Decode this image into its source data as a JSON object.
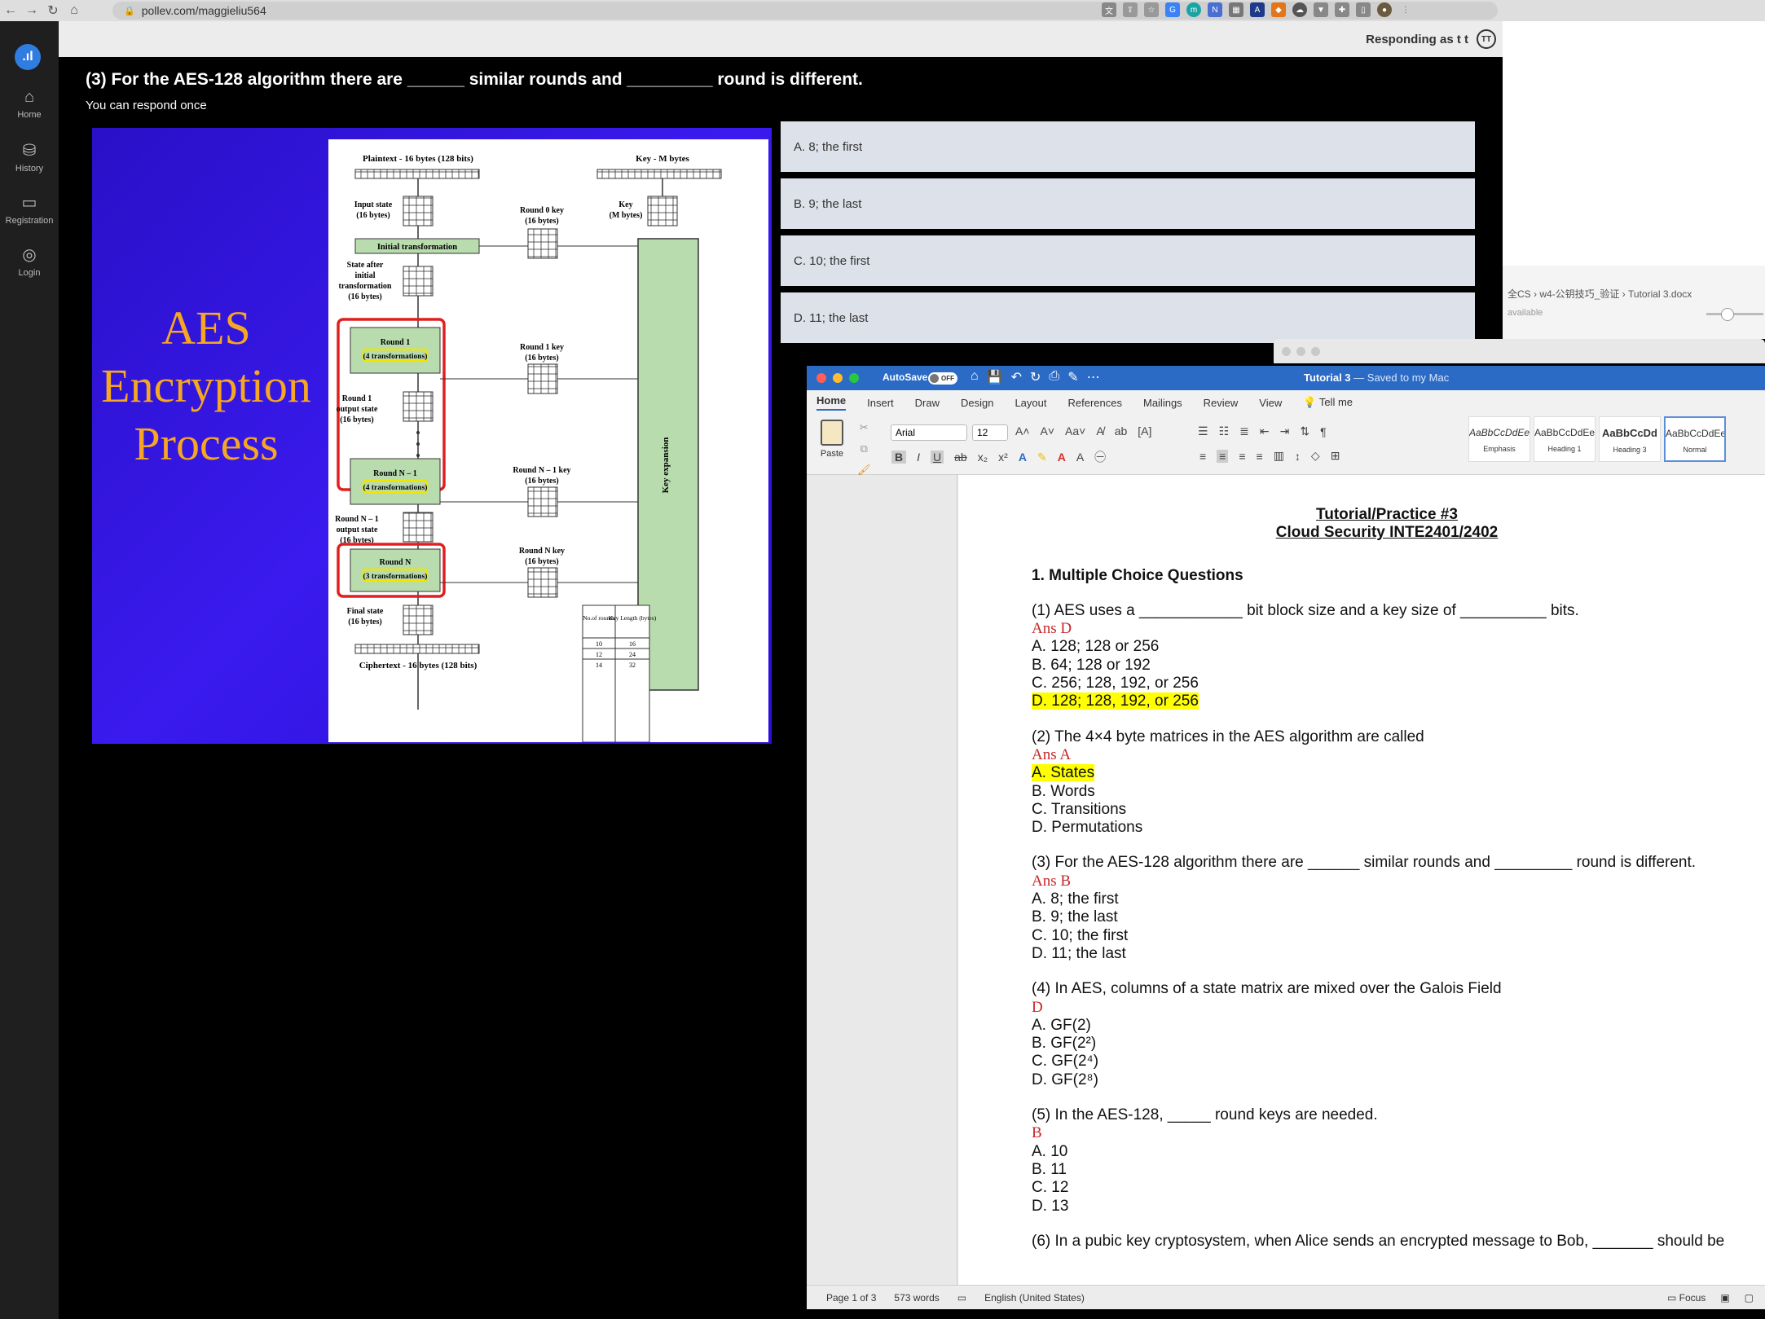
{
  "browser": {
    "url": "pollev.com/maggieliu564"
  },
  "rail": {
    "items": [
      {
        "label": "Home",
        "icon": "home-icon"
      },
      {
        "label": "History",
        "icon": "history-icon"
      },
      {
        "label": "Registration",
        "icon": "registration-icon"
      },
      {
        "label": "Login",
        "icon": "login-icon"
      }
    ]
  },
  "poll": {
    "responding": "Responding as t t",
    "avatar": "TT",
    "question": "(3) For the AES-128 algorithm there are ______ similar rounds and _________ round is different.",
    "note": "You can respond once",
    "options": [
      "A. 8; the first",
      "B. 9; the last",
      "C. 10; the first",
      "D. 11; the last"
    ],
    "slide": {
      "title_lines": [
        "AES",
        "Encryption",
        "Process"
      ],
      "plaintext": "Plaintext - 16 bytes (128 bits)",
      "key": "Key - M bytes",
      "input_state": [
        "Input state",
        "(16 bytes)"
      ],
      "key_m": [
        "Key",
        "(M bytes)"
      ],
      "round0_key": [
        "Round 0 key",
        "(16 bytes)"
      ],
      "initial_transformation": "Initial transformation",
      "state_after": [
        "State after",
        "initial",
        "transformation",
        "(16 bytes)"
      ],
      "round1": [
        "Round 1",
        "(4 transformations)"
      ],
      "round1_key": [
        "Round 1 key",
        "(16 bytes)"
      ],
      "key_expansion": "Key expansion",
      "round1_output": [
        "Round 1",
        "output state",
        "(16 bytes)"
      ],
      "roundN1": [
        "Round N – 1",
        "(4 transformations)"
      ],
      "roundN1_key": [
        "Round N – 1 key",
        "(16 bytes)"
      ],
      "roundN1_output": [
        "Round N – 1",
        "output state",
        "(16 bytes)"
      ],
      "roundN": [
        "Round N",
        "(3 transformations)"
      ],
      "roundN_key": [
        "Round N key",
        "(16 bytes)"
      ],
      "final_state": [
        "Final state",
        "(16 bytes)"
      ],
      "ciphertext": "Ciphertext - 16 bytes (128 bits)",
      "table_headers": [
        "No.of rounds",
        "Key Length (bytes)"
      ],
      "table_rows": [
        [
          "10",
          "16"
        ],
        [
          "12",
          "24"
        ],
        [
          "14",
          "32"
        ]
      ]
    }
  },
  "finder": {
    "path": "全CS › w4-公钥技巧_验证 › Tutorial 3.docx",
    "available": "available"
  },
  "word": {
    "autosave": "AutoSave",
    "toggle": "OFF",
    "doc_title": "Tutorial 3",
    "saved": " — Saved to my Mac",
    "tabs": [
      "Home",
      "Insert",
      "Draw",
      "Design",
      "Layout",
      "References",
      "Mailings",
      "Review",
      "View",
      "Tell me"
    ],
    "paste": "Paste",
    "font": "Arial",
    "size": "12",
    "styles": [
      {
        "sample": "AaBbCcDdEe",
        "name": "Emphasis"
      },
      {
        "sample": "AaBbCcDdEe",
        "name": "Heading 1"
      },
      {
        "sample": "AaBbCcDd",
        "name": "Heading 3"
      },
      {
        "sample": "AaBbCcDdEe",
        "name": "Normal"
      }
    ],
    "status": {
      "page": "Page 1 of 3",
      "words": "573 words",
      "lang": "English (United States)",
      "focus": "Focus"
    }
  },
  "doc": {
    "title1": "Tutorial/Practice #3",
    "title2": "Cloud Security INTE2401/2402",
    "section": "1. Multiple Choice Questions",
    "q1": "(1) AES uses a ____________ bit block size and a key size of __________ bits.",
    "q1_ans": "Ans D",
    "q1_opts": [
      "A. 128; 128 or 256",
      "B.  64; 128 or 192",
      "C.  256; 128, 192, or 256",
      "D.  128; 128, 192, or 256"
    ],
    "q2": "(2) The 4×4 byte matrices in the AES algorithm are called",
    "q2_ans": "Ans A",
    "q2_opts": [
      "A. States",
      "B. Words",
      "C. Transitions",
      "D. Permutations"
    ],
    "q3": "(3) For the AES-128 algorithm there are ______ similar rounds and _________ round is different.",
    "q3_ans": "Ans B",
    "q3_opts": [
      "A. 8; the first",
      "B. 9; the last",
      "C. 10; the first",
      "D. 11; the last"
    ],
    "q4": "(4) In AES, columns of a state matrix are mixed over the Galois Field",
    "q4_ans": "D",
    "q4_opts": [
      "A. GF(2)",
      "B. GF(2²)",
      "C. GF(2⁴)",
      "D. GF(2⁸)"
    ],
    "q5": "(5) In the AES-128, _____ round keys are needed.",
    "q5_ans": "B",
    "q5_opts": [
      "A. 10",
      "B. 11",
      "C. 12",
      "D. 13"
    ],
    "q6": "(6) In a pubic key cryptosystem, when Alice sends an encrypted message to Bob, _______ should be"
  }
}
